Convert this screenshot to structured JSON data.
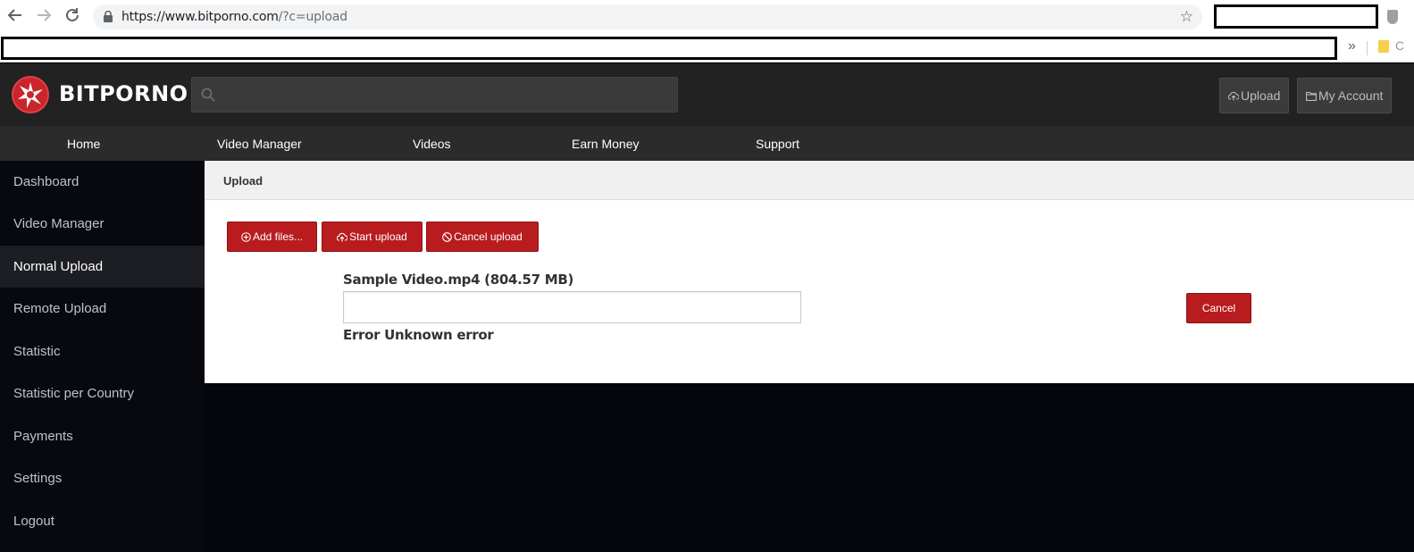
{
  "browser": {
    "url_host": "https://www.bitporno.com",
    "url_path": "/?c=upload",
    "overflow_chevrons": "»",
    "bookmark_partial": "C"
  },
  "header": {
    "logo_text": "BITPORNO",
    "search_placeholder": "",
    "upload_label": "Upload",
    "account_label": "My Account"
  },
  "nav": {
    "items": [
      "Home",
      "Video Manager",
      "Videos",
      "Earn Money",
      "Support"
    ]
  },
  "sidebar": {
    "items": [
      {
        "label": "Dashboard"
      },
      {
        "label": "Video Manager"
      },
      {
        "label": "Normal Upload",
        "active": true
      },
      {
        "label": "Remote Upload"
      },
      {
        "label": "Statistic"
      },
      {
        "label": "Statistic per Country"
      },
      {
        "label": "Payments"
      },
      {
        "label": "Settings"
      },
      {
        "label": "Logout"
      }
    ]
  },
  "panel": {
    "title": "Upload",
    "add_files_label": "Add files...",
    "start_upload_label": "Start upload",
    "cancel_upload_label": "Cancel upload",
    "file_name": "Sample Video.mp4 (804.57 MB)",
    "progress": 0,
    "status": "Error Unknown error",
    "cancel_label": "Cancel"
  },
  "colors": {
    "brand_red": "#b81c1f",
    "header_bg": "#222222",
    "nav_bg": "#2b2b2b",
    "sidebar_bg": "#07090f"
  },
  "icons": [
    "back-arrow-icon",
    "forward-arrow-icon",
    "reload-icon",
    "lock-icon",
    "star-icon",
    "search-icon",
    "cloud-upload-icon",
    "folder-icon",
    "plus-circle-icon",
    "ban-icon"
  ]
}
